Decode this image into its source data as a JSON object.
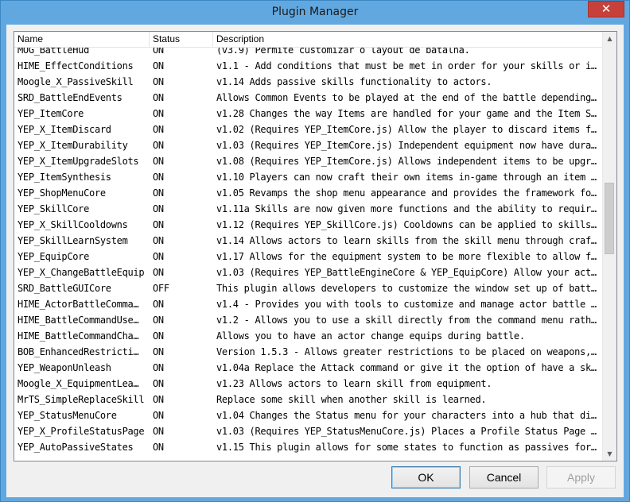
{
  "window": {
    "title": "Plugin Manager",
    "close_glyph": "✕"
  },
  "columns": {
    "name": "Name",
    "status": "Status",
    "description": "Description"
  },
  "rows": [
    {
      "name": "MOG_BattleHud",
      "status": "ON",
      "description": "(v3.9) Permite customizar o layout de batalha."
    },
    {
      "name": "HIME_EffectConditions",
      "status": "ON",
      "description": "v1.1 - Add conditions that must be met in order for your skills or i…"
    },
    {
      "name": "Moogle_X_PassiveSkill",
      "status": "ON",
      "description": "v1.14 Adds passive skills functionality to actors."
    },
    {
      "name": "SRD_BattleEndEvents",
      "status": "ON",
      "description": "Allows Common Events to be played at the end of the battle depending…"
    },
    {
      "name": "YEP_ItemCore",
      "status": "ON",
      "description": "v1.28 Changes the way Items are handled for your game and the Item S…"
    },
    {
      "name": "YEP_X_ItemDiscard",
      "status": "ON",
      "description": "v1.02 (Requires YEP_ItemCore.js) Allow the player to discard items f…"
    },
    {
      "name": "YEP_X_ItemDurability",
      "status": "ON",
      "description": "v1.03 (Requires YEP_ItemCore.js) Independent equipment now have dura…"
    },
    {
      "name": "YEP_X_ItemUpgradeSlots",
      "status": "ON",
      "description": "v1.08 (Requires YEP_ItemCore.js) Allows independent items to be upgr…"
    },
    {
      "name": "YEP_ItemSynthesis",
      "status": "ON",
      "description": "v1.10 Players can now craft their own items in-game through an item …"
    },
    {
      "name": "YEP_ShopMenuCore",
      "status": "ON",
      "description": "v1.05 Revamps the shop menu appearance and provides the framework fo…"
    },
    {
      "name": "YEP_SkillCore",
      "status": "ON",
      "description": "v1.11a Skills are now given more functions and the ability to requir…"
    },
    {
      "name": "YEP_X_SkillCooldowns",
      "status": "ON",
      "description": "v1.12 (Requires YEP_SkillCore.js) Cooldowns can be applied to skills…"
    },
    {
      "name": "YEP_SkillLearnSystem",
      "status": "ON",
      "description": "v1.14 Allows actors to learn skills from the skill menu through craf…"
    },
    {
      "name": "YEP_EquipCore",
      "status": "ON",
      "description": "v1.17 Allows for the equipment system to be more flexible to allow f…"
    },
    {
      "name": "YEP_X_ChangeBattleEquip",
      "status": "ON",
      "description": "v1.03 (Requires YEP_BattleEngineCore & YEP_EquipCore) Allow your act…"
    },
    {
      "name": "SRD_BattleGUICore",
      "status": "OFF",
      "description": "This plugin allows developers to customize the window set up of batt…"
    },
    {
      "name": "HIME_ActorBattleComma…",
      "status": "ON",
      "description": "v1.4 - Provides you with tools to customize and manage actor battle …"
    },
    {
      "name": "HIME_BattleCommandUse…",
      "status": "ON",
      "description": "v1.2 - Allows you to use a skill directly from the command menu rath…"
    },
    {
      "name": "HIME_BattleCommandCha…",
      "status": "ON",
      "description": "Allows you to have an actor change equips during battle."
    },
    {
      "name": "BOB_EnhancedRestricti…",
      "status": "ON",
      "description": "Version 1.5.3 - Allows greater restrictions to be placed on weapons,…"
    },
    {
      "name": "YEP_WeaponUnleash",
      "status": "ON",
      "description": "v1.04a Replace the Attack command or give it the option of have a sk…"
    },
    {
      "name": "Moogle_X_EquipmentLea…",
      "status": "ON",
      "description": "v1.23 Allows actors to learn skill from equipment."
    },
    {
      "name": "MrTS_SimpleReplaceSkill",
      "status": "ON",
      "description": "Replace some skill when another skill is learned."
    },
    {
      "name": "YEP_StatusMenuCore",
      "status": "ON",
      "description": "v1.04 Changes the Status menu for your characters into a hub that di…"
    },
    {
      "name": "YEP_X_ProfileStatusPage",
      "status": "ON",
      "description": "v1.03 (Requires YEP_StatusMenuCore.js) Places a Profile Status Page …"
    },
    {
      "name": "YEP_AutoPassiveStates",
      "status": "ON",
      "description": "v1.15 This plugin allows for some states to function as passives for…"
    }
  ],
  "buttons": {
    "ok": "OK",
    "cancel": "Cancel",
    "apply": "Apply"
  },
  "scroll": {
    "up_glyph": "▲",
    "down_glyph": "▼"
  }
}
